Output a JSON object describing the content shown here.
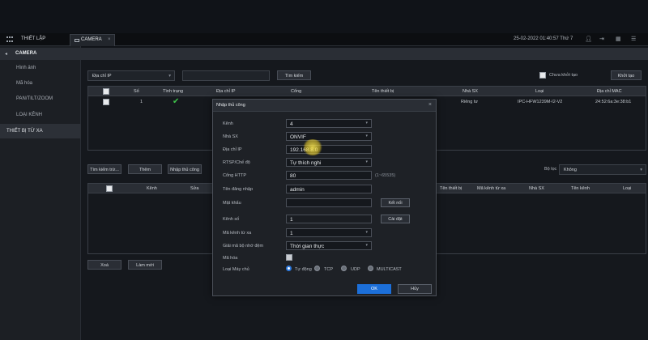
{
  "topbar": {
    "setup_label": "THIẾT LẬP",
    "tab_label": "CAMERA",
    "tab_close": "×",
    "datetime": "25-02-2022 01:40:57 Thứ 7",
    "icons": [
      "user-icon",
      "logout-icon",
      "grid-icon",
      "menu-icon"
    ]
  },
  "sidebar": {
    "title": "CAMERA",
    "arrow": "◂",
    "items": [
      "Hình ảnh",
      "Mã hóa",
      "PAN/TILT/ZOOM",
      "LOẠI KÊNH",
      "THIẾT BỊ TỪ XA"
    ],
    "active_index": 4
  },
  "main": {
    "search_type": "Địa chỉ IP",
    "search_value": "",
    "search_button": "Tìm kiếm",
    "uninit_label": "Chưa khởi tạo",
    "init_button": "Khởi tạo",
    "top_table": {
      "headers": [
        "",
        "Số",
        "Tình trạng",
        "Địa chỉ IP",
        "Cổng",
        "Tên thiết bị",
        "Nhà SX",
        "Loại",
        "Địa chỉ MAC"
      ],
      "row": {
        "num": "1",
        "status": "✔",
        "vendor": "Riêng tư",
        "type": "IPC-HFW1239M-I2-V2",
        "mac": "24:52:6a:3e:38:b1"
      }
    },
    "buttons": [
      "Tìm kiếm trừ...",
      "Thêm",
      "Nhập thủ công"
    ],
    "filter_label": "Bộ lọc",
    "filter_value": "Không",
    "bottom_table": {
      "headers_left": [
        "",
        "Kênh",
        "Sửa"
      ],
      "headers_right": [
        "Tên thiết bị",
        "Mã kênh từ xa",
        "Nhà SX",
        "Tên kênh",
        "Loại"
      ]
    },
    "delete_button": "Xoá",
    "refresh_button": "Làm mới"
  },
  "modal": {
    "title": "Nhập thủ công",
    "close": "×",
    "labels": [
      "Kênh",
      "Nhà SX",
      "Địa chỉ IP",
      "RTSP/Chế độ",
      "Cổng HTTP",
      "Tên đăng nhập",
      "Mật khẩu",
      "Kênh số",
      "Mã kênh từ xa",
      "Giải mã bộ nhớ đệm",
      "Mã hóa",
      "Loại Máy chủ"
    ],
    "channel": "4",
    "vendor": "ONVIF",
    "ip": "192.168.8.0",
    "rtsp_mode": "Tự thích nghi",
    "http_port": "80",
    "port_range": "(1~65535)",
    "username": "admin",
    "password": "",
    "connect_button": "Kết nối",
    "channel_no": "1",
    "setup_button": "Cài đặt",
    "remote_channel": "1",
    "buffer": "Thời gian thực",
    "server_types": [
      "Tự động",
      "TCP",
      "UDP",
      "MULTICAST"
    ],
    "server_selected": 0,
    "ok": "OK",
    "cancel": "Hủy"
  }
}
